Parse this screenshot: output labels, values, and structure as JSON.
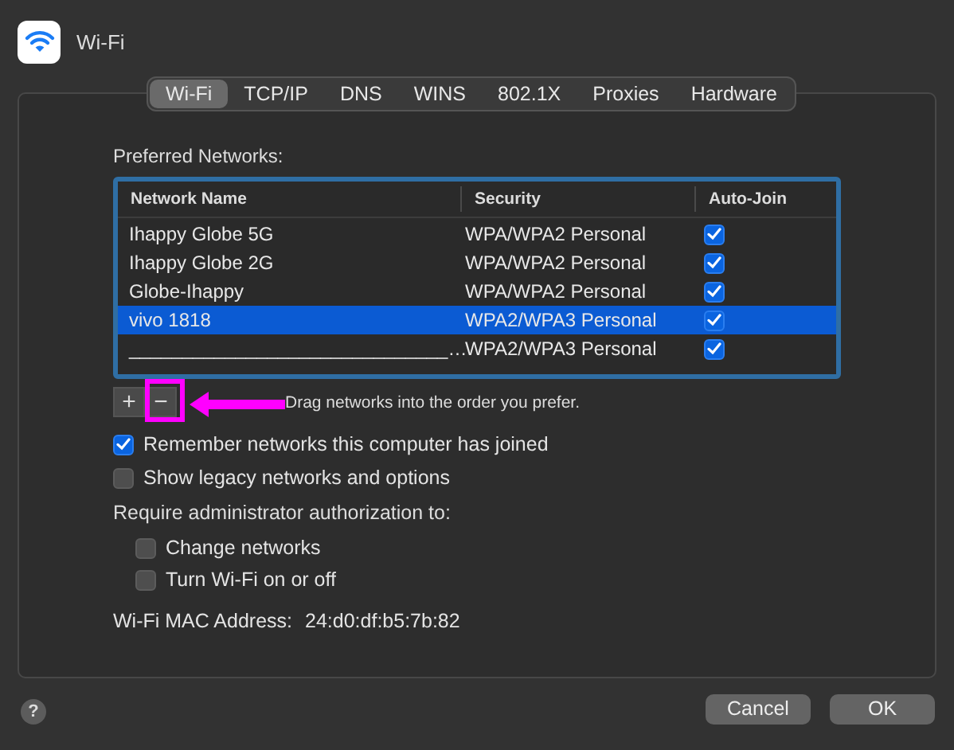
{
  "window": {
    "title": "Wi-Fi"
  },
  "tabs": [
    {
      "label": "Wi-Fi",
      "selected": true
    },
    {
      "label": "TCP/IP",
      "selected": false
    },
    {
      "label": "DNS",
      "selected": false
    },
    {
      "label": "WINS",
      "selected": false
    },
    {
      "label": "802.1X",
      "selected": false
    },
    {
      "label": "Proxies",
      "selected": false
    },
    {
      "label": "Hardware",
      "selected": false
    }
  ],
  "preferred_networks": {
    "label": "Preferred Networks:",
    "columns": [
      "Network Name",
      "Security",
      "Auto-Join"
    ],
    "rows": [
      {
        "name": "Ihappy Globe 5G",
        "security": "WPA/WPA2 Personal",
        "auto_join": true,
        "selected": false
      },
      {
        "name": "Ihappy Globe 2G",
        "security": "WPA/WPA2 Personal",
        "auto_join": true,
        "selected": false
      },
      {
        "name": "Globe-Ihappy",
        "security": "WPA/WPA2 Personal",
        "auto_join": true,
        "selected": false
      },
      {
        "name": "vivo 1818",
        "security": "WPA2/WPA3 Personal",
        "auto_join": true,
        "selected": true
      },
      {
        "name": "______________________________…",
        "security": "WPA2/WPA3 Personal",
        "auto_join": true,
        "selected": false
      }
    ],
    "add_button": "+",
    "remove_button": "−",
    "hint": "Drag networks into the order you prefer."
  },
  "options": [
    {
      "label": "Remember networks this computer has joined",
      "checked": true
    },
    {
      "label": "Show legacy networks and options",
      "checked": false
    }
  ],
  "admin": {
    "label": "Require administrator authorization to:",
    "options": [
      {
        "label": "Change networks",
        "checked": false
      },
      {
        "label": "Turn Wi-Fi on or off",
        "checked": false
      }
    ]
  },
  "mac_address": {
    "label": "Wi-Fi MAC Address:",
    "value": "24:d0:df:b5:7b:82"
  },
  "buttons": [
    {
      "label": "Cancel"
    },
    {
      "label": "OK"
    }
  ],
  "help_button": "?"
}
